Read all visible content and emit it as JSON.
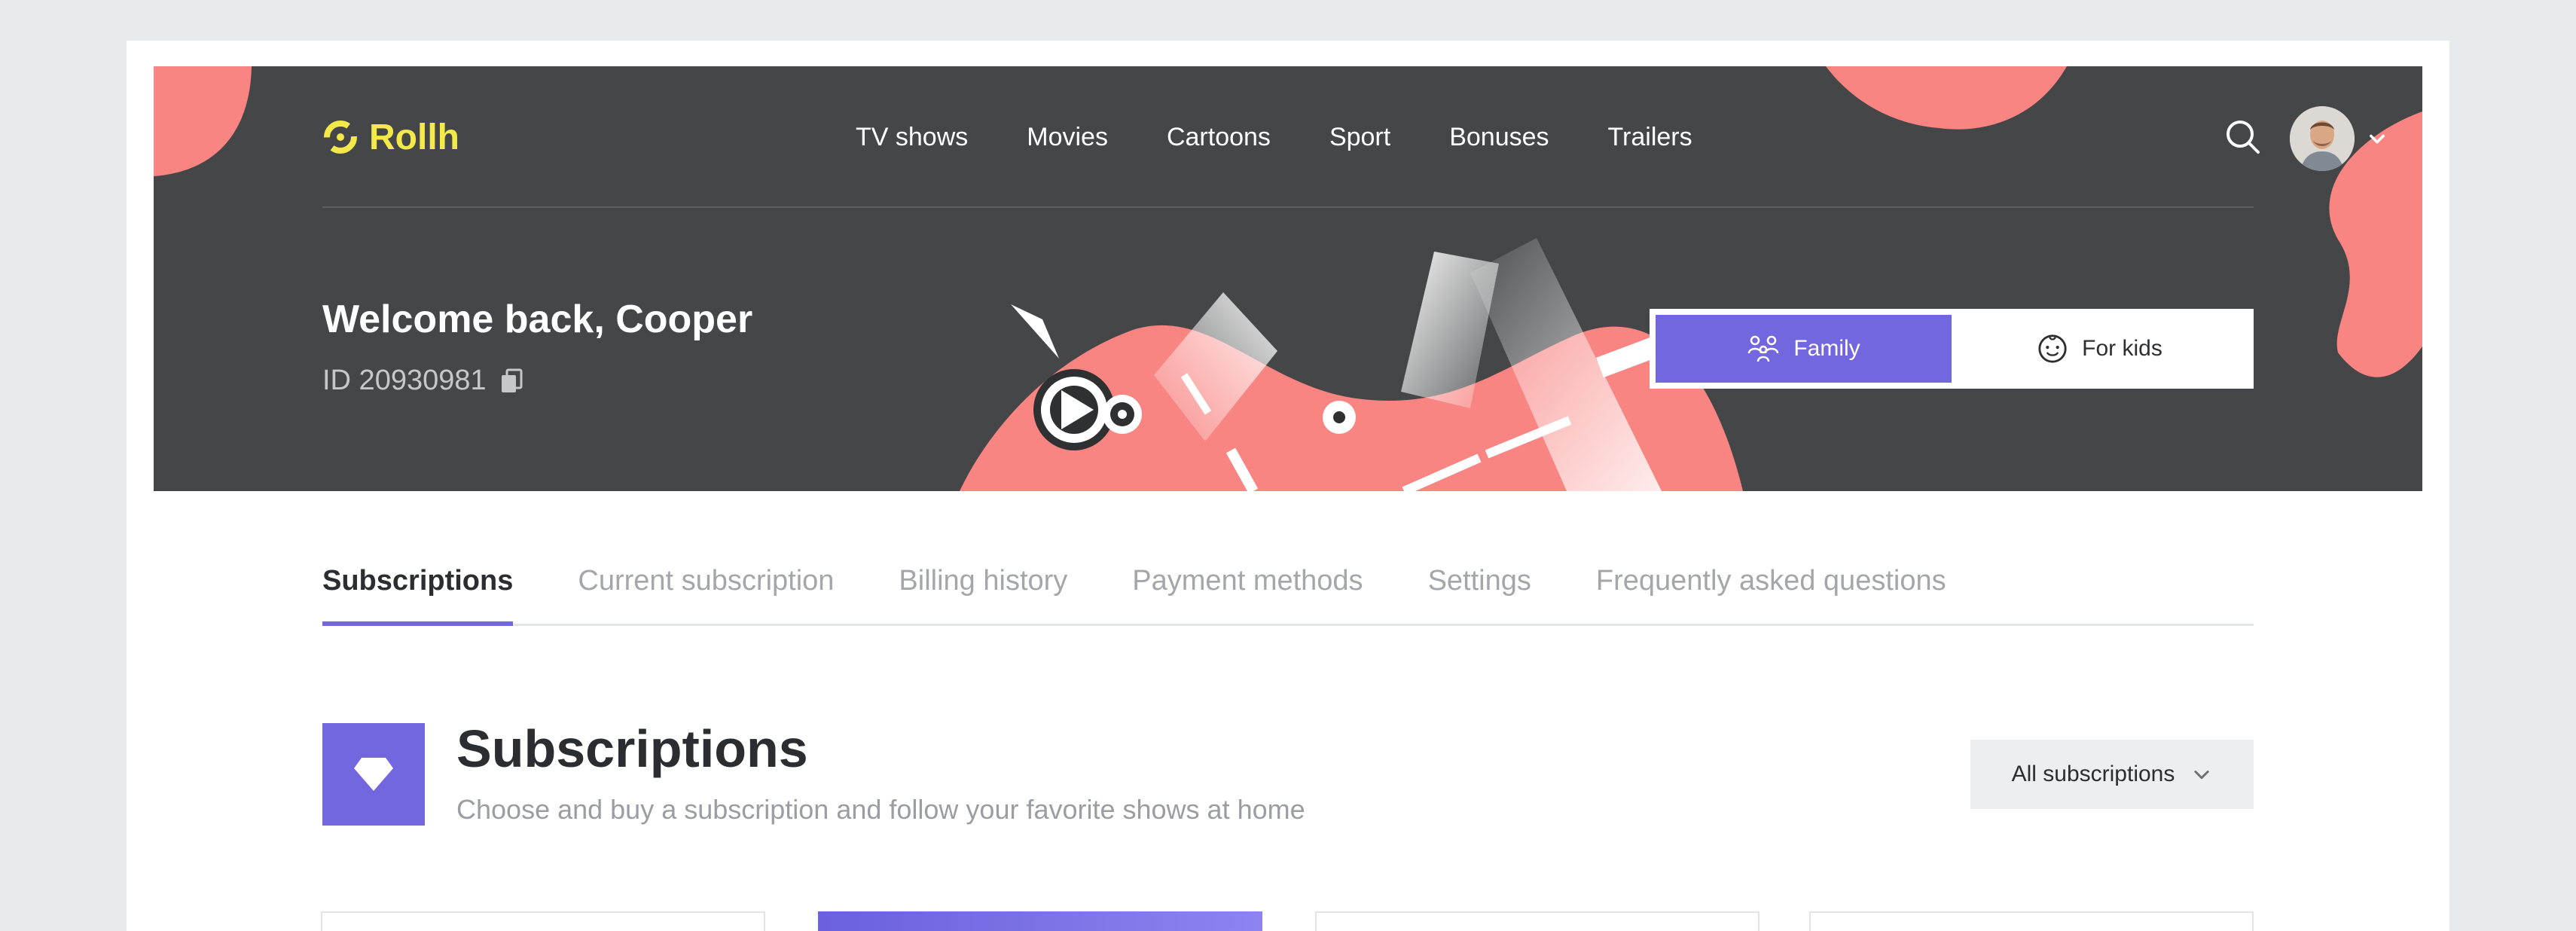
{
  "brand": {
    "name": "Rollh",
    "accent": "#f3e94b",
    "primary": "#7367e0",
    "coral": "#f88582"
  },
  "nav": {
    "items": [
      "TV shows",
      "Movies",
      "Cartoons",
      "Sport",
      "Bonuses",
      "Trailers"
    ],
    "search_icon": "search-icon",
    "avatar_icon": "user-avatar",
    "dropdown_icon": "chevron-down-icon"
  },
  "hero": {
    "welcome": "Welcome back, Cooper",
    "id_text": "ID 20930981",
    "copy_icon": "copy-icon",
    "profile_toggle": {
      "family": "Family",
      "kids": "For kids",
      "selected": "Family"
    }
  },
  "tabs": {
    "items": [
      "Subscriptions",
      "Current subscription",
      "Billing history",
      "Payment methods",
      "Settings",
      "Frequently asked questions"
    ],
    "active": "Subscriptions"
  },
  "section": {
    "icon": "diamond-icon",
    "title": "Subscriptions",
    "subtitle": "Choose and buy a subscription and follow your favorite shows at home",
    "filter_label": "All subscriptions"
  }
}
